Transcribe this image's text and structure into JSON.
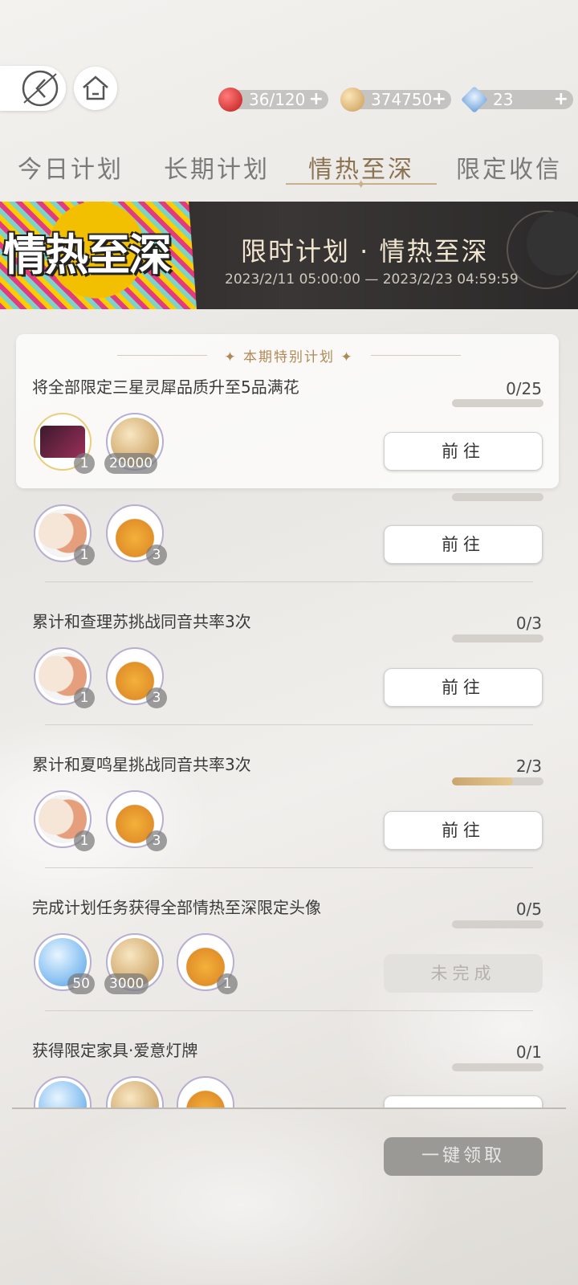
{
  "top": {
    "resources": [
      {
        "name": "stamina",
        "value": "36/120",
        "plus": "+"
      },
      {
        "name": "gold",
        "value": "374750",
        "plus": "+"
      },
      {
        "name": "diamond",
        "value": "23",
        "plus": "+"
      }
    ]
  },
  "tabs": [
    "今日计划",
    "长期计划",
    "情热至深",
    "限定收信"
  ],
  "banner": {
    "logo": "情热至深",
    "title": "限时计划 · 情热至深",
    "dates": "2023/2/11 05:00:00 — 2023/2/23 04:59:59"
  },
  "special": {
    "header": "本期特别计划",
    "title": "将全部限定三星灵犀品质升至5品满花",
    "progress": "0/25",
    "progress_fraction": 0,
    "items": [
      "1",
      "20000"
    ],
    "button": "前往"
  },
  "tasks": [
    {
      "title": "",
      "progress": "",
      "progress_fraction": 0,
      "items": [
        "1",
        "3"
      ],
      "button": "前往"
    },
    {
      "title": "累计和查理苏挑战同音共率3次",
      "progress": "0/3",
      "progress_fraction": 0,
      "items": [
        "1",
        "3"
      ],
      "button": "前往"
    },
    {
      "title": "累计和夏鸣星挑战同音共率3次",
      "progress": "2/3",
      "progress_fraction": 0.667,
      "items": [
        "1",
        "3"
      ],
      "button": "前往"
    },
    {
      "title": "完成计划任务获得全部情热至深限定头像",
      "progress": "0/5",
      "progress_fraction": 0,
      "items": [
        "50",
        "3000",
        "1"
      ],
      "button": "未完成"
    },
    {
      "title": "获得限定家具·爱意灯牌",
      "progress": "0/1",
      "progress_fraction": 0,
      "items": [],
      "button": ""
    }
  ],
  "claim_all": "一键领取",
  "colors": {
    "accent": "#8c7352",
    "bar": "#d4b07a"
  }
}
